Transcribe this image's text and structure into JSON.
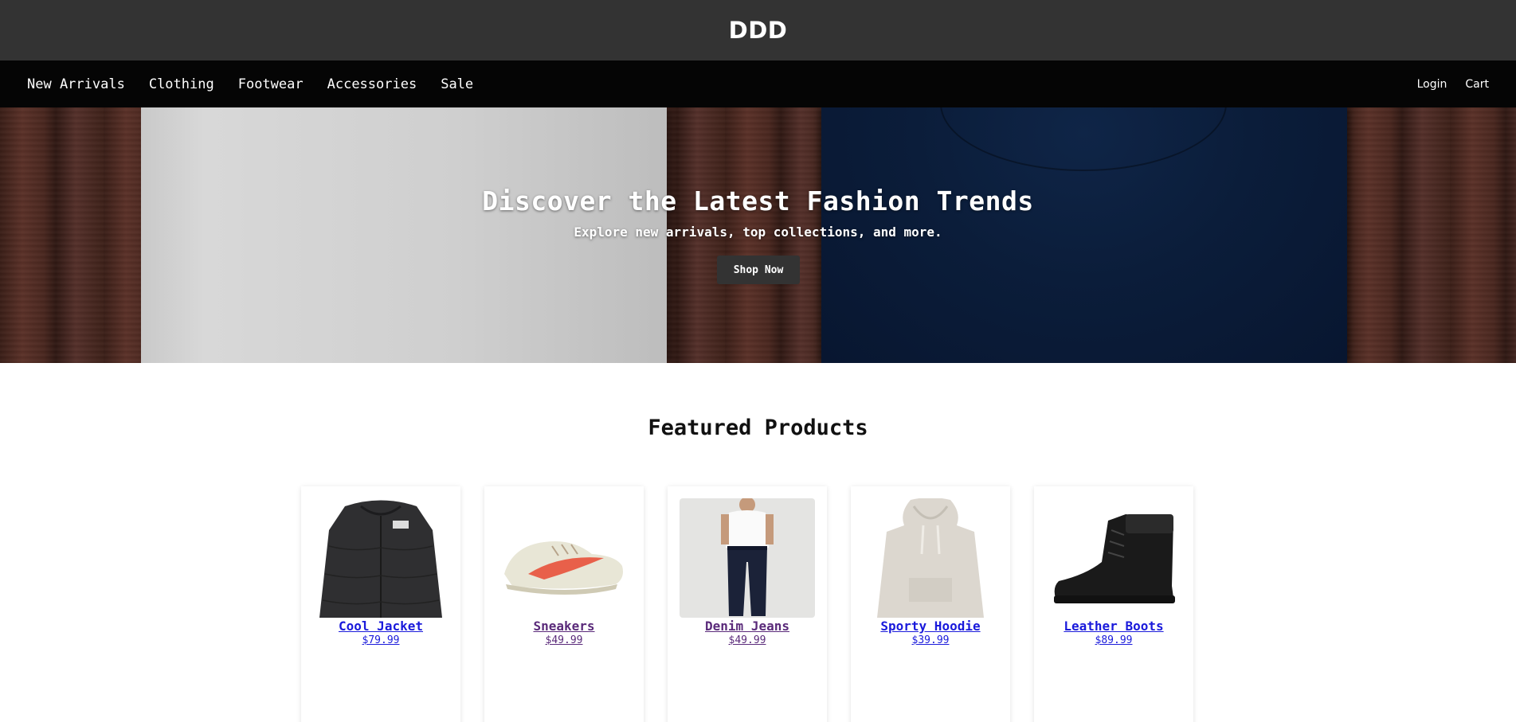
{
  "site": {
    "brand": "DDD"
  },
  "nav": {
    "left": [
      {
        "label": "New Arrivals"
      },
      {
        "label": "Clothing"
      },
      {
        "label": "Footwear"
      },
      {
        "label": "Accessories"
      },
      {
        "label": "Sale"
      }
    ],
    "right": [
      {
        "label": "Login"
      },
      {
        "label": "Cart"
      }
    ]
  },
  "hero": {
    "title": "Discover the Latest Fashion Trends",
    "subtitle": "Explore new arrivals, top collections, and more.",
    "cta_label": "Shop Now"
  },
  "featured": {
    "title": "Featured Products",
    "products": [
      {
        "name": "Cool Jacket",
        "price": "$79.99",
        "icon": "jacket-image"
      },
      {
        "name": "Sneakers",
        "price": "$49.99",
        "icon": "sneakers-image"
      },
      {
        "name": "Denim Jeans",
        "price": "$49.99",
        "icon": "jeans-image"
      },
      {
        "name": "Sporty Hoodie",
        "price": "$39.99",
        "icon": "hoodie-image"
      },
      {
        "name": "Leather Boots",
        "price": "$89.99",
        "icon": "boots-image"
      }
    ]
  },
  "colors": {
    "header_bg": "#333333",
    "nav_bg": "#050505",
    "link": "#1a1adb",
    "visited_link": "#5a2a7a"
  }
}
